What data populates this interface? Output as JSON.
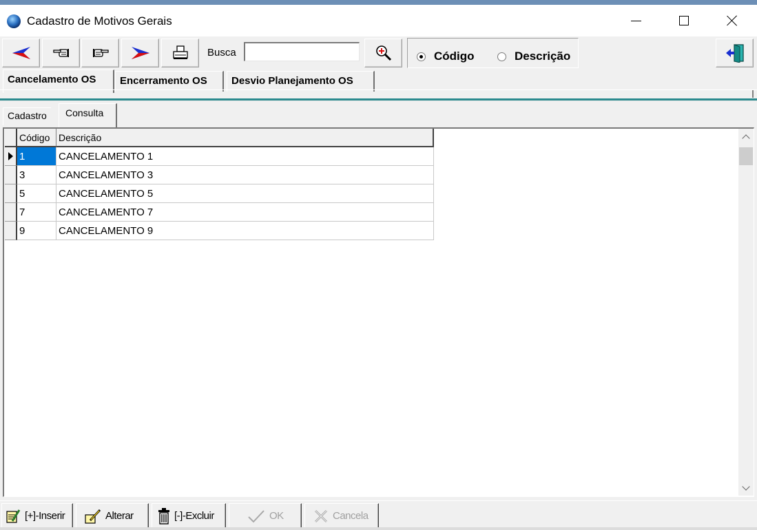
{
  "window": {
    "title": "Cadastro de Motivos Gerais",
    "icon": "app-globe-icon"
  },
  "toolbar": {
    "first_icon": "arrow-left-icon",
    "prev_icon": "hand-left-icon",
    "next_icon": "hand-right-icon",
    "last_icon": "arrow-right-icon",
    "print_icon": "printer-icon",
    "search_label": "Busca",
    "search_value": "",
    "zoom_icon": "magnifier-icon",
    "radio_options": [
      "Código",
      "Descrição"
    ],
    "radio_selected": "Código",
    "exit_icon": "exit-door-icon"
  },
  "tabs": {
    "items": [
      "Cancelamento OS",
      "Encerramento OS",
      "Desvio Planejamento OS"
    ],
    "active": "Cancelamento OS"
  },
  "subtabs": {
    "items": [
      "Cadastro",
      "Consulta"
    ],
    "active": "Consulta"
  },
  "grid": {
    "columns": [
      "Código",
      "Descrição"
    ],
    "rows": [
      {
        "codigo": "1",
        "descricao": "CANCELAMENTO 1"
      },
      {
        "codigo": "3",
        "descricao": "CANCELAMENTO 3"
      },
      {
        "codigo": "5",
        "descricao": "CANCELAMENTO 5"
      },
      {
        "codigo": "7",
        "descricao": "CANCELAMENTO 7"
      },
      {
        "codigo": "9",
        "descricao": "CANCELAMENTO 9"
      }
    ],
    "selected_row": 0
  },
  "actions": {
    "insert": "[+]-Inserir",
    "edit": "Alterar",
    "delete": "[-]-Excluir",
    "ok": "OK",
    "cancel": "Cancela"
  },
  "colors": {
    "accent_blue": "#0078d7",
    "tab_divider_teal": "#2b8a8e",
    "arrow_blue": "#1a2fd0",
    "arrow_red": "#d81010"
  }
}
